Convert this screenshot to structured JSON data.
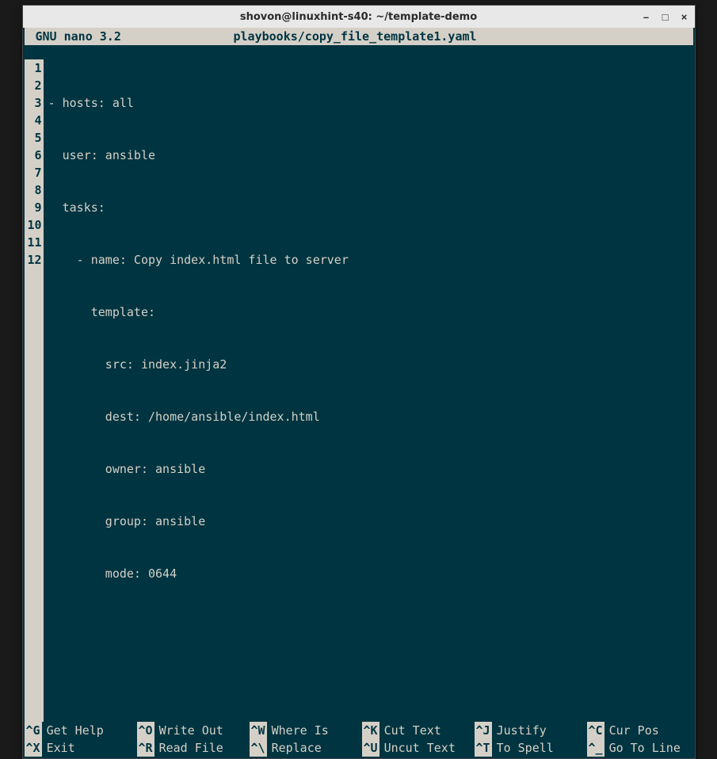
{
  "window": {
    "title": "shovon@linuxhint-s40: ~/template-demo"
  },
  "nano": {
    "app": "GNU nano 3.2",
    "filename": "playbooks/copy_file_template1.yaml"
  },
  "lines": [
    "- hosts: all",
    "  user: ansible",
    "  tasks:",
    "    - name: Copy index.html file to server",
    "      template:",
    "        src: index.jinja2",
    "        dest: /home/ansible/index.html",
    "        owner: ansible",
    "        group: ansible",
    "        mode: 0644",
    "",
    ""
  ],
  "line_numbers": [
    "1",
    "2",
    "3",
    "4",
    "5",
    "6",
    "7",
    "8",
    "9",
    "10",
    "11",
    "12"
  ],
  "shortcuts": {
    "row1": [
      {
        "key": "^G",
        "label": "Get Help"
      },
      {
        "key": "^O",
        "label": "Write Out"
      },
      {
        "key": "^W",
        "label": "Where Is"
      },
      {
        "key": "^K",
        "label": "Cut Text"
      },
      {
        "key": "^J",
        "label": "Justify"
      },
      {
        "key": "^C",
        "label": "Cur Pos"
      }
    ],
    "row2": [
      {
        "key": "^X",
        "label": "Exit"
      },
      {
        "key": "^R",
        "label": "Read File"
      },
      {
        "key": "^\\",
        "label": "Replace"
      },
      {
        "key": "^U",
        "label": "Uncut Text"
      },
      {
        "key": "^T",
        "label": "To Spell"
      },
      {
        "key": "^_",
        "label": "Go To Line"
      }
    ]
  }
}
